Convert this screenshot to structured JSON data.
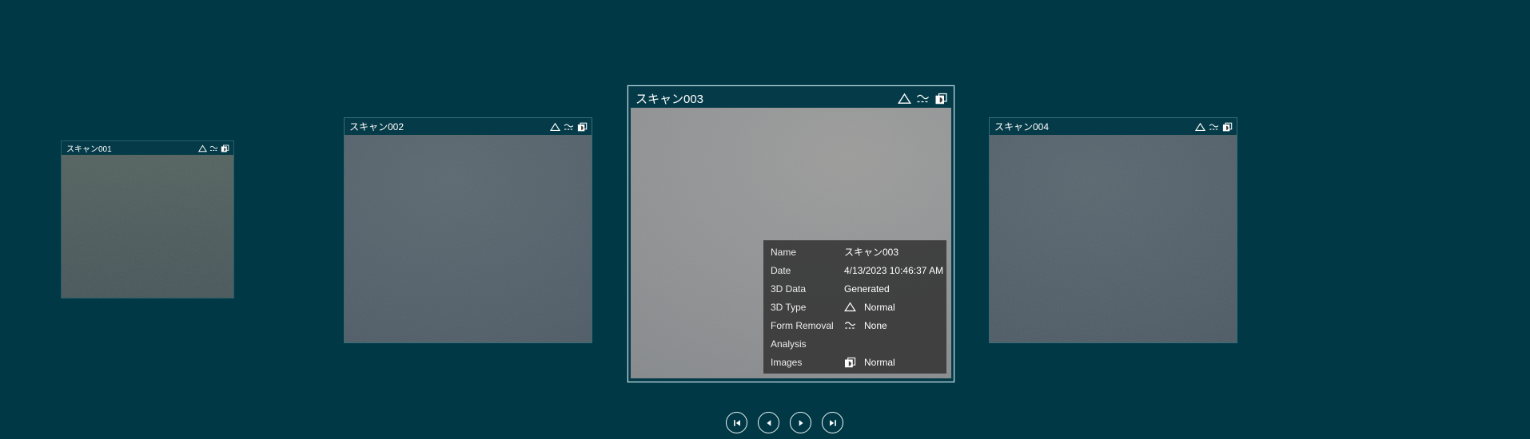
{
  "colors": {
    "background": "#003845",
    "selected_card_border": "#cfe6ee",
    "info_panel_background": "#3a3a3a",
    "icon_color": "#ffffff"
  },
  "cards": [
    {
      "title": "スキャン001",
      "selected": false
    },
    {
      "title": "スキャン002",
      "selected": false
    },
    {
      "title": "スキャン003",
      "selected": true
    },
    {
      "title": "スキャン004",
      "selected": false
    }
  ],
  "card_status_icons": [
    "3d-type-triangle-icon",
    "form-removal-icon",
    "images-icon"
  ],
  "info_panel": {
    "rows": [
      {
        "label": "Name",
        "value": "スキャン003"
      },
      {
        "label": "Date",
        "value": "4/13/2023 10:46:37 AM"
      },
      {
        "label": "3D Data",
        "value": "Generated"
      },
      {
        "label": "3D Type",
        "value": "Normal",
        "icon": "triangle-icon"
      },
      {
        "label": "Form Removal",
        "value": "None",
        "icon": "form-removal-icon"
      },
      {
        "label": "Analysis",
        "value": ""
      },
      {
        "label": "Images",
        "value": "Normal",
        "icon": "images-icon"
      }
    ]
  },
  "navigation": {
    "first_label": "First",
    "previous_label": "Previous",
    "next_label": "Next",
    "last_label": "Last"
  }
}
